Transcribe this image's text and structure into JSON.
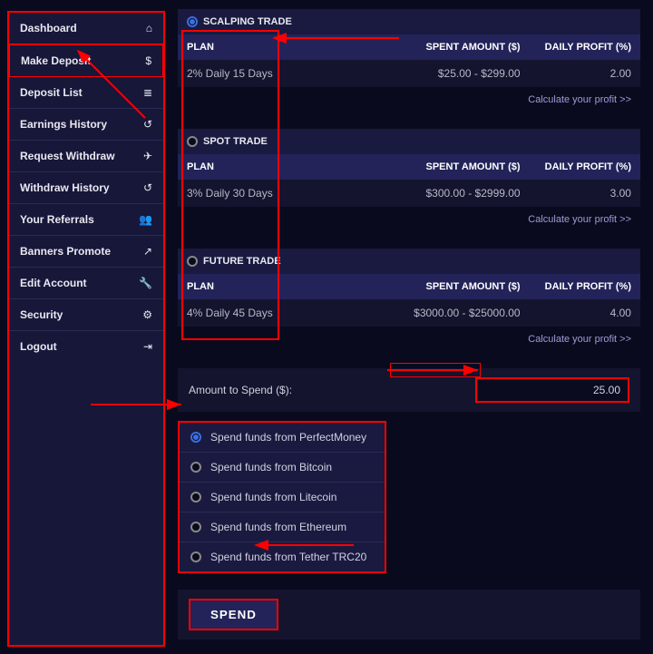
{
  "sidebar": {
    "items": [
      {
        "label": "Dashboard",
        "icon": "⌂"
      },
      {
        "label": "Make Deposit",
        "icon": "$"
      },
      {
        "label": "Deposit List",
        "icon": "≣"
      },
      {
        "label": "Earnings History",
        "icon": "↺"
      },
      {
        "label": "Request Withdraw",
        "icon": "✈"
      },
      {
        "label": "Withdraw History",
        "icon": "↺"
      },
      {
        "label": "Your Referrals",
        "icon": "👥"
      },
      {
        "label": "Banners Promote",
        "icon": "↗"
      },
      {
        "label": "Edit Account",
        "icon": "🔧"
      },
      {
        "label": "Security",
        "icon": "⚙"
      },
      {
        "label": "Logout",
        "icon": "⇥"
      }
    ]
  },
  "plans": [
    {
      "name": "SCALPING TRADE",
      "selected": true,
      "plan": "2% Daily 15 Days",
      "spent": "$25.00 - $299.00",
      "profit": "2.00"
    },
    {
      "name": "SPOT TRADE",
      "selected": false,
      "plan": "3% Daily 30 Days",
      "spent": "$300.00 - $2999.00",
      "profit": "3.00"
    },
    {
      "name": "FUTURE TRADE",
      "selected": false,
      "plan": "4% Daily 45 Days",
      "spent": "$3000.00 - $25000.00",
      "profit": "4.00"
    }
  ],
  "columns": {
    "plan": "PLAN",
    "spent": "SPENT AMOUNT ($)",
    "profit": "DAILY PROFIT (%)"
  },
  "calc_link": "Calculate your profit >>",
  "amount": {
    "label": "Amount to Spend ($):",
    "value": "25.00"
  },
  "pay_methods": [
    {
      "label": "Spend funds from PerfectMoney",
      "selected": true
    },
    {
      "label": "Spend funds from Bitcoin",
      "selected": false
    },
    {
      "label": "Spend funds from Litecoin",
      "selected": false
    },
    {
      "label": "Spend funds from Ethereum",
      "selected": false
    },
    {
      "label": "Spend funds from Tether TRC20",
      "selected": false
    }
  ],
  "spend_button": "SPEND"
}
